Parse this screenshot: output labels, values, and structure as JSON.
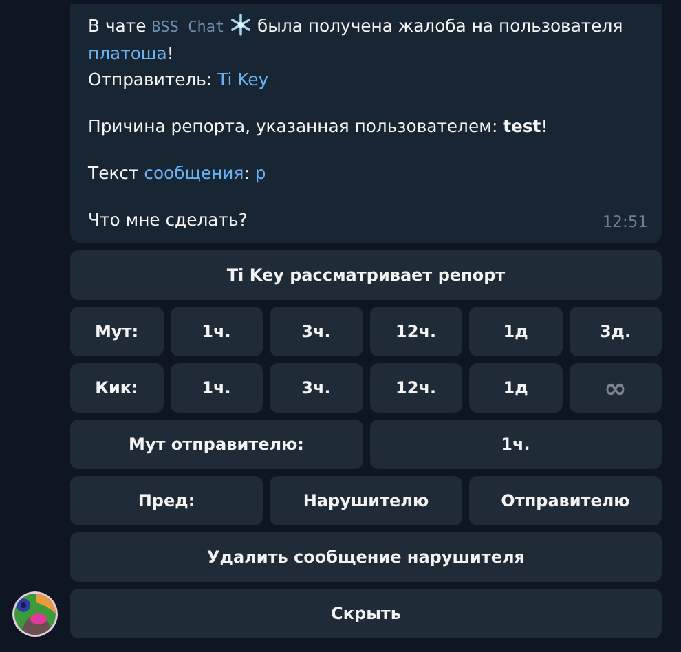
{
  "message": {
    "paragraphs": [
      [
        [
          {
            "kind": "plain",
            "text": "В чате "
          },
          {
            "kind": "chat",
            "text": "BSS Chat"
          },
          {
            "kind": "plain",
            "text": " была получена жалоба на пользователя"
          }
        ],
        [
          {
            "kind": "link",
            "text": "платоша"
          },
          {
            "kind": "plain",
            "text": "!"
          }
        ],
        [
          {
            "kind": "plain",
            "text": "Отправитель: "
          },
          {
            "kind": "link",
            "text": "Ti Key"
          }
        ]
      ],
      [
        [
          {
            "kind": "plain",
            "text": "Причина репорта, указанная пользователем: "
          },
          {
            "kind": "bold",
            "text": "test"
          },
          {
            "kind": "plain",
            "text": "!"
          }
        ]
      ],
      [
        [
          {
            "kind": "plain",
            "text": "Текст "
          },
          {
            "kind": "link",
            "text": "сообщения"
          },
          {
            "kind": "plain",
            "text": ": "
          },
          {
            "kind": "link",
            "text": "р"
          }
        ]
      ],
      [
        [
          {
            "kind": "plain",
            "text": "Что мне сделать?"
          }
        ]
      ]
    ],
    "time": "12:51"
  },
  "keyboard": [
    [
      {
        "kind": "text",
        "label": "Ti Key рассматривает репорт"
      }
    ],
    [
      {
        "kind": "text",
        "label": "Мут:"
      },
      {
        "kind": "text",
        "label": "1ч."
      },
      {
        "kind": "text",
        "label": "3ч."
      },
      {
        "kind": "text",
        "label": "12ч."
      },
      {
        "kind": "text",
        "label": "1д"
      },
      {
        "kind": "text",
        "label": "3д."
      }
    ],
    [
      {
        "kind": "text",
        "label": "Кик:"
      },
      {
        "kind": "text",
        "label": "1ч."
      },
      {
        "kind": "text",
        "label": "3ч."
      },
      {
        "kind": "text",
        "label": "12ч."
      },
      {
        "kind": "text",
        "label": "1д"
      },
      {
        "kind": "symbol",
        "label": "∞"
      }
    ],
    [
      {
        "kind": "text",
        "label": "Мут отправителю:"
      },
      {
        "kind": "text",
        "label": "1ч."
      }
    ],
    [
      {
        "kind": "text",
        "label": "Пред:"
      },
      {
        "kind": "text",
        "label": "Нарушителю"
      },
      {
        "kind": "text",
        "label": "Отправителю"
      }
    ],
    [
      {
        "kind": "text",
        "label": "Удалить сообщение нарушителя"
      }
    ],
    [
      {
        "kind": "text",
        "label": "Скрыть"
      }
    ]
  ]
}
